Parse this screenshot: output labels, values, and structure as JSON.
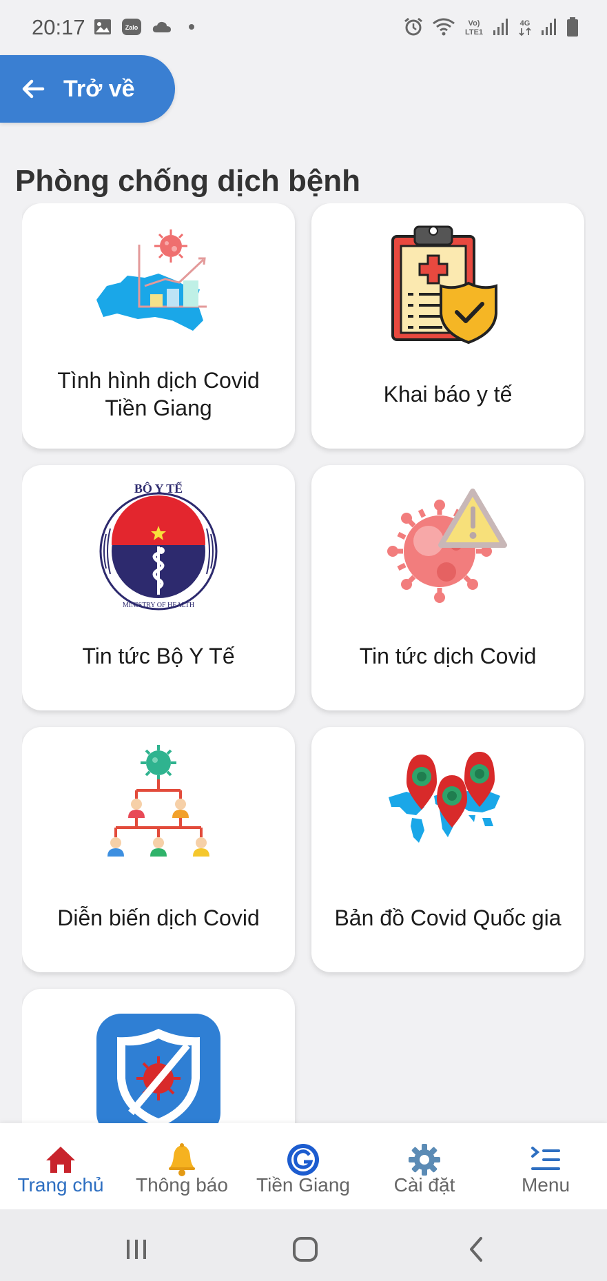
{
  "status_bar": {
    "time": "20:17",
    "left_icons": [
      "image-icon",
      "zalo-icon",
      "cloud-icon",
      "dot-icon"
    ],
    "right_icons": [
      "alarm-icon",
      "wifi-icon",
      "volte-icon",
      "signal-icon",
      "4g-icon",
      "signal-icon",
      "battery-icon"
    ],
    "volte_text": "Vo)\nLTE1",
    "lte_text": "4G"
  },
  "header": {
    "back_label": "Trở về",
    "accent": "#3a7fd2"
  },
  "section": {
    "title": "Phòng chống dịch bệnh"
  },
  "cards": [
    {
      "label": "Tình hình dịch Covid Tiền Giang",
      "icon": "map-chart-virus-icon"
    },
    {
      "label": "Khai báo y tế",
      "icon": "medical-clipboard-shield-icon"
    },
    {
      "label": "Tin tức Bộ Y Tế",
      "icon": "ministry-of-health-logo"
    },
    {
      "label": "Tin tức dịch Covid",
      "icon": "virus-warning-icon"
    },
    {
      "label": "Diễn biến dịch Covid",
      "icon": "virus-spread-tree-icon"
    },
    {
      "label": "Bản đồ Covid Quốc gia",
      "icon": "world-map-pins-icon"
    },
    {
      "label": "",
      "icon": "bluezone-shield-icon"
    }
  ],
  "logo_text": {
    "top": "BỘ Y TẾ",
    "bottom": "MINISTRY OF HEALTH"
  },
  "bottom_nav": [
    {
      "label": "Trang chủ",
      "icon": "home-icon",
      "active": true
    },
    {
      "label": "Thông báo",
      "icon": "bell-icon",
      "active": false
    },
    {
      "label": "Tiền Giang",
      "icon": "tien-giang-logo-icon",
      "active": false
    },
    {
      "label": "Cài đặt",
      "icon": "gear-icon",
      "active": false
    },
    {
      "label": "Menu",
      "icon": "menu-icon",
      "active": false
    }
  ],
  "system_nav": [
    "recents-icon",
    "home-circle-icon",
    "back-chevron-icon"
  ],
  "colors": {
    "accent": "#3a7fd2",
    "active_nav": "#2e6fc1",
    "background": "#f1f1f3"
  }
}
